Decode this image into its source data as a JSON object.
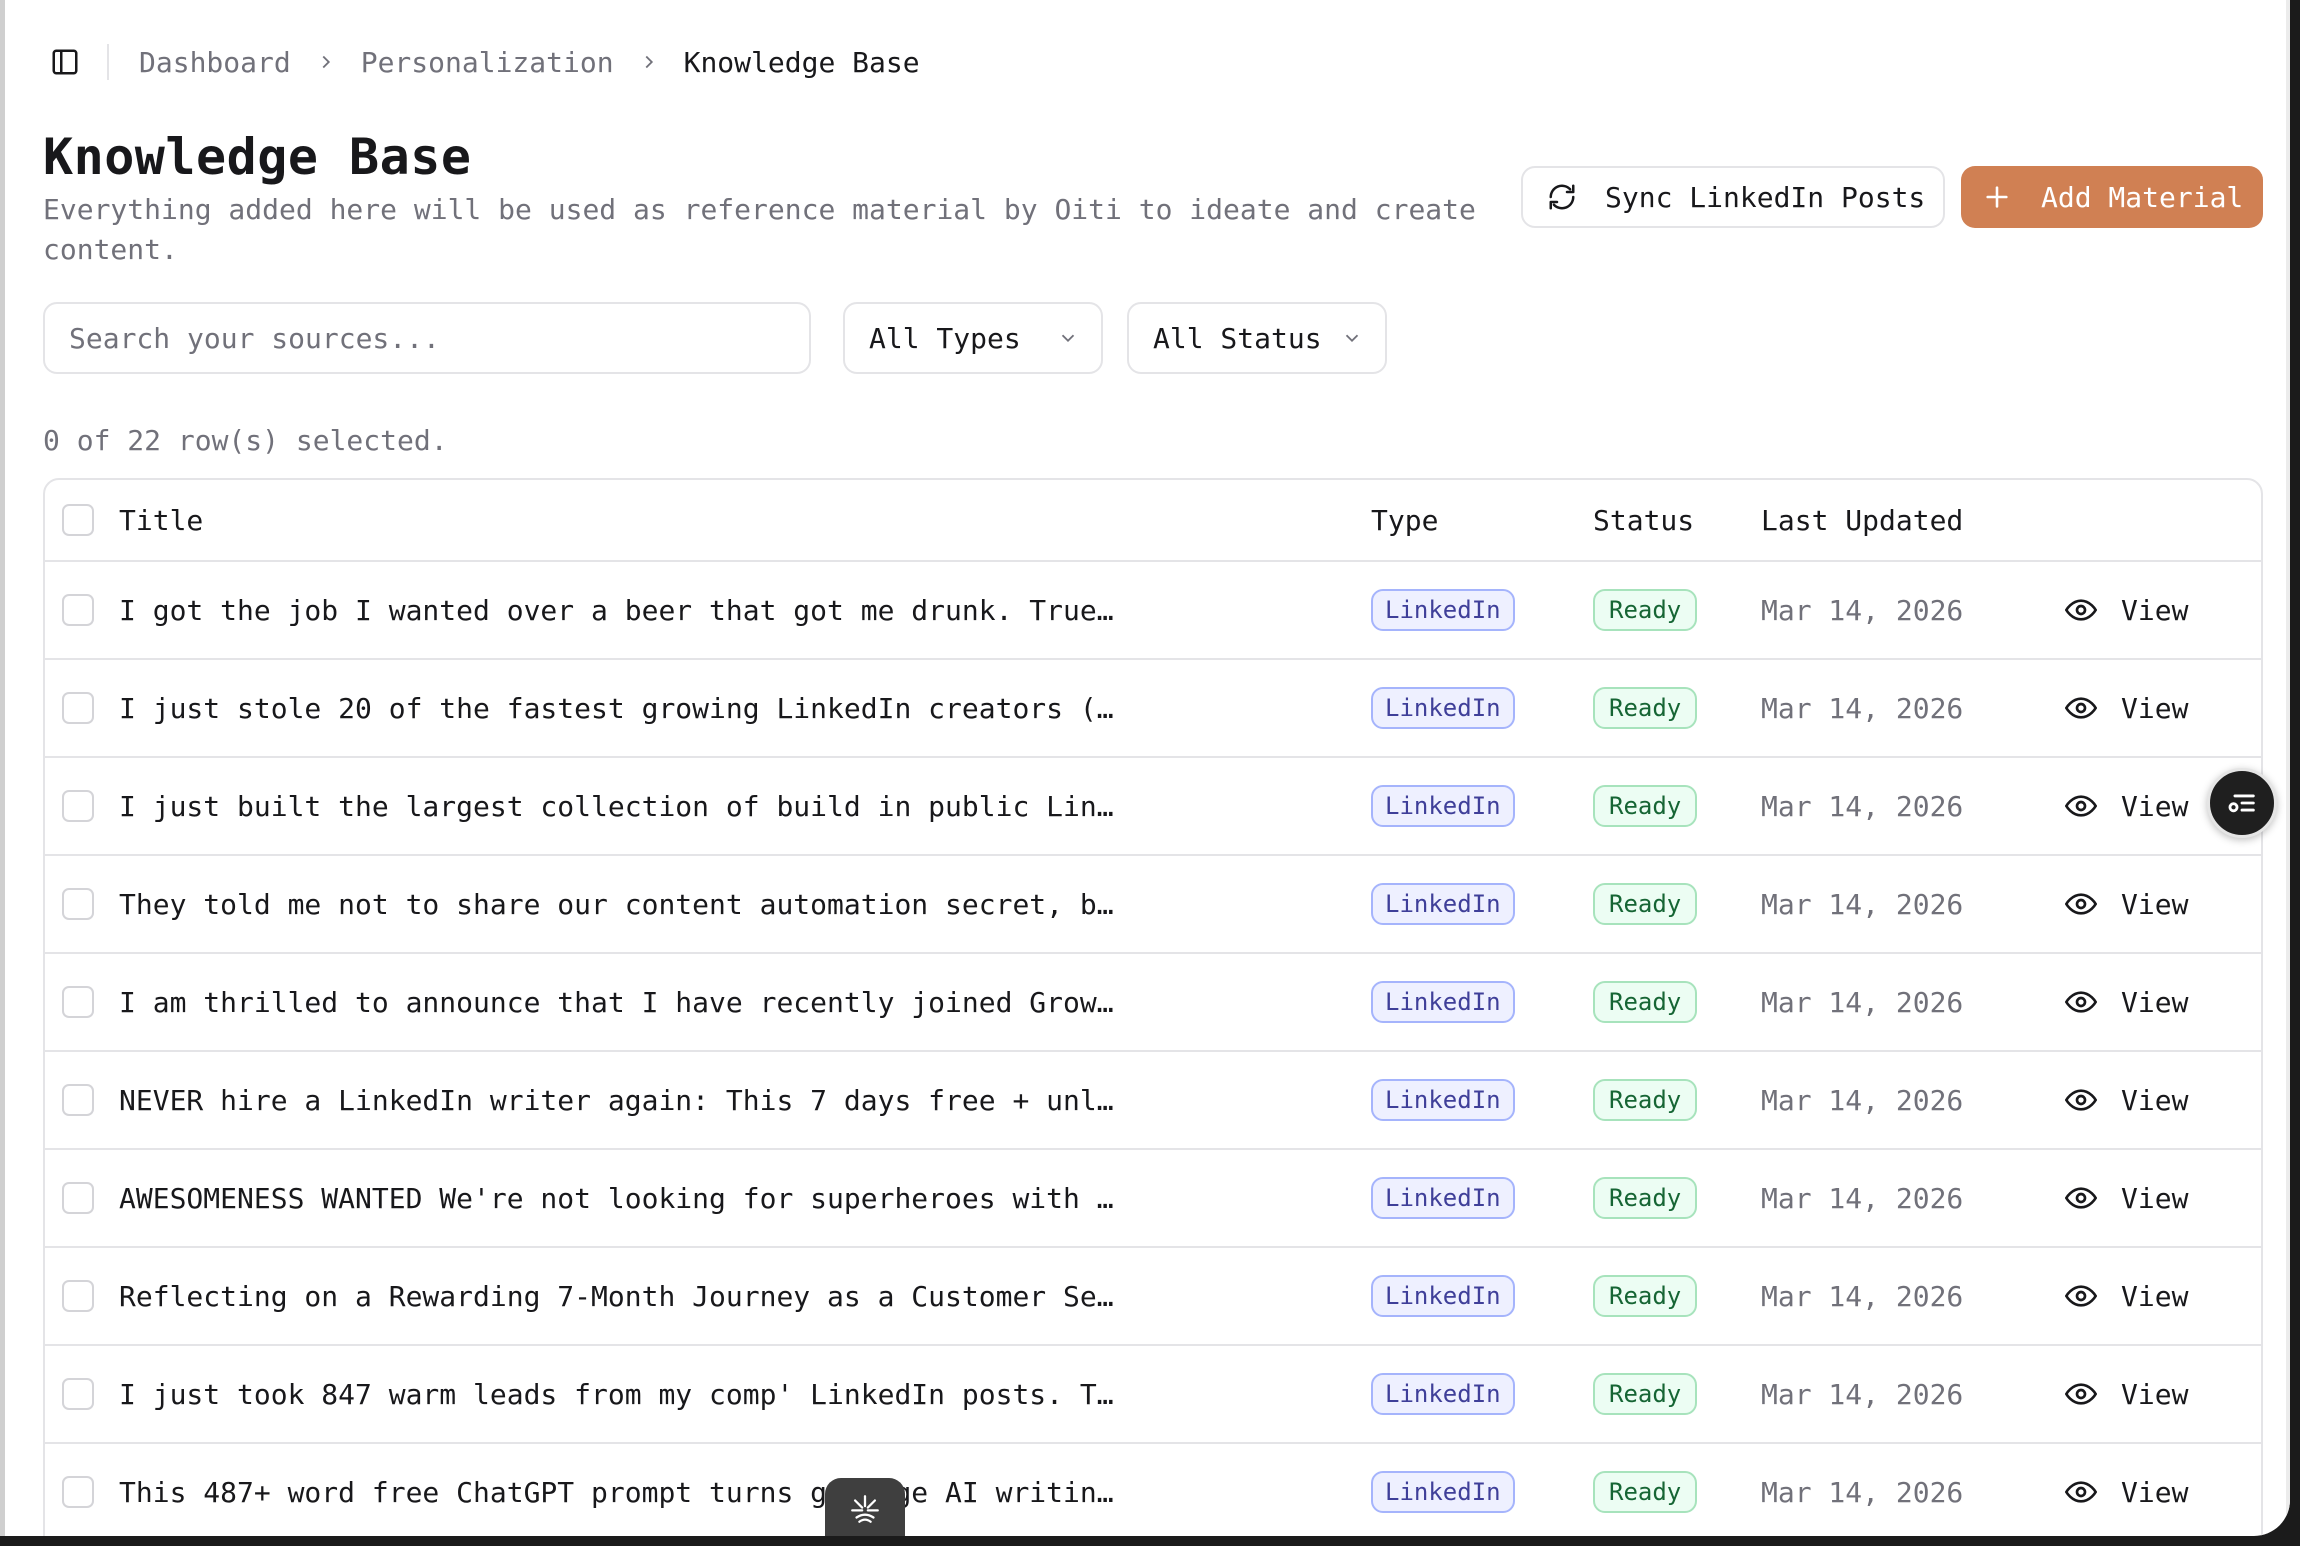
{
  "breadcrumb": {
    "items": [
      {
        "label": "Dashboard"
      },
      {
        "label": "Personalization"
      },
      {
        "label": "Knowledge Base"
      }
    ]
  },
  "header": {
    "title": "Knowledge Base",
    "description": "Everything added here will be used as reference material by Oiti to ideate and create content.",
    "sync_label": "Sync LinkedIn Posts",
    "add_label": "Add Material"
  },
  "filters": {
    "search_placeholder": "Search your sources...",
    "type_value": "All Types",
    "status_value": "All Status"
  },
  "selection": {
    "text": "0 of 22 row(s) selected."
  },
  "table": {
    "columns": {
      "title": "Title",
      "type": "Type",
      "status": "Status",
      "updated": "Last Updated"
    },
    "view_label": "View",
    "rows": [
      {
        "title": "I got the job I wanted over a beer that got me drunk. True…",
        "type": "LinkedIn",
        "status": "Ready",
        "updated": "Mar 14, 2026"
      },
      {
        "title": "I just stole 20 of the fastest growing LinkedIn creators (…",
        "type": "LinkedIn",
        "status": "Ready",
        "updated": "Mar 14, 2026"
      },
      {
        "title": "I just built the largest collection of build in public Lin…",
        "type": "LinkedIn",
        "status": "Ready",
        "updated": "Mar 14, 2026"
      },
      {
        "title": "They told me not to share our content automation secret, b…",
        "type": "LinkedIn",
        "status": "Ready",
        "updated": "Mar 14, 2026"
      },
      {
        "title": "I am thrilled to announce that I have recently joined Grow…",
        "type": "LinkedIn",
        "status": "Ready",
        "updated": "Mar 14, 2026"
      },
      {
        "title": "NEVER hire a LinkedIn writer again: This 7 days free + unl…",
        "type": "LinkedIn",
        "status": "Ready",
        "updated": "Mar 14, 2026"
      },
      {
        "title": "AWESOMENESS WANTED We're not looking for superheroes with …",
        "type": "LinkedIn",
        "status": "Ready",
        "updated": "Mar 14, 2026"
      },
      {
        "title": "Reflecting on a Rewarding 7-Month Journey as a Customer Se…",
        "type": "LinkedIn",
        "status": "Ready",
        "updated": "Mar 14, 2026"
      },
      {
        "title": "I just took 847 warm leads from my comp' LinkedIn posts. T…",
        "type": "LinkedIn",
        "status": "Ready",
        "updated": "Mar 14, 2026"
      },
      {
        "title": "This 487+ word free ChatGPT prompt turns garbage AI writin…",
        "type": "LinkedIn",
        "status": "Ready",
        "updated": "Mar 14, 2026"
      }
    ]
  },
  "colors": {
    "accent": "#d08053",
    "type_badge_bg": "#eef0ff",
    "status_badge_bg": "#ecfdf3"
  },
  "icons": {
    "sidebar_toggle": "sidebar-icon",
    "sync": "refresh-icon",
    "add": "plus-icon",
    "dropdown": "chevron-down-icon",
    "view": "eye-icon",
    "fab": "list-icon",
    "dock": "burst-icon"
  }
}
